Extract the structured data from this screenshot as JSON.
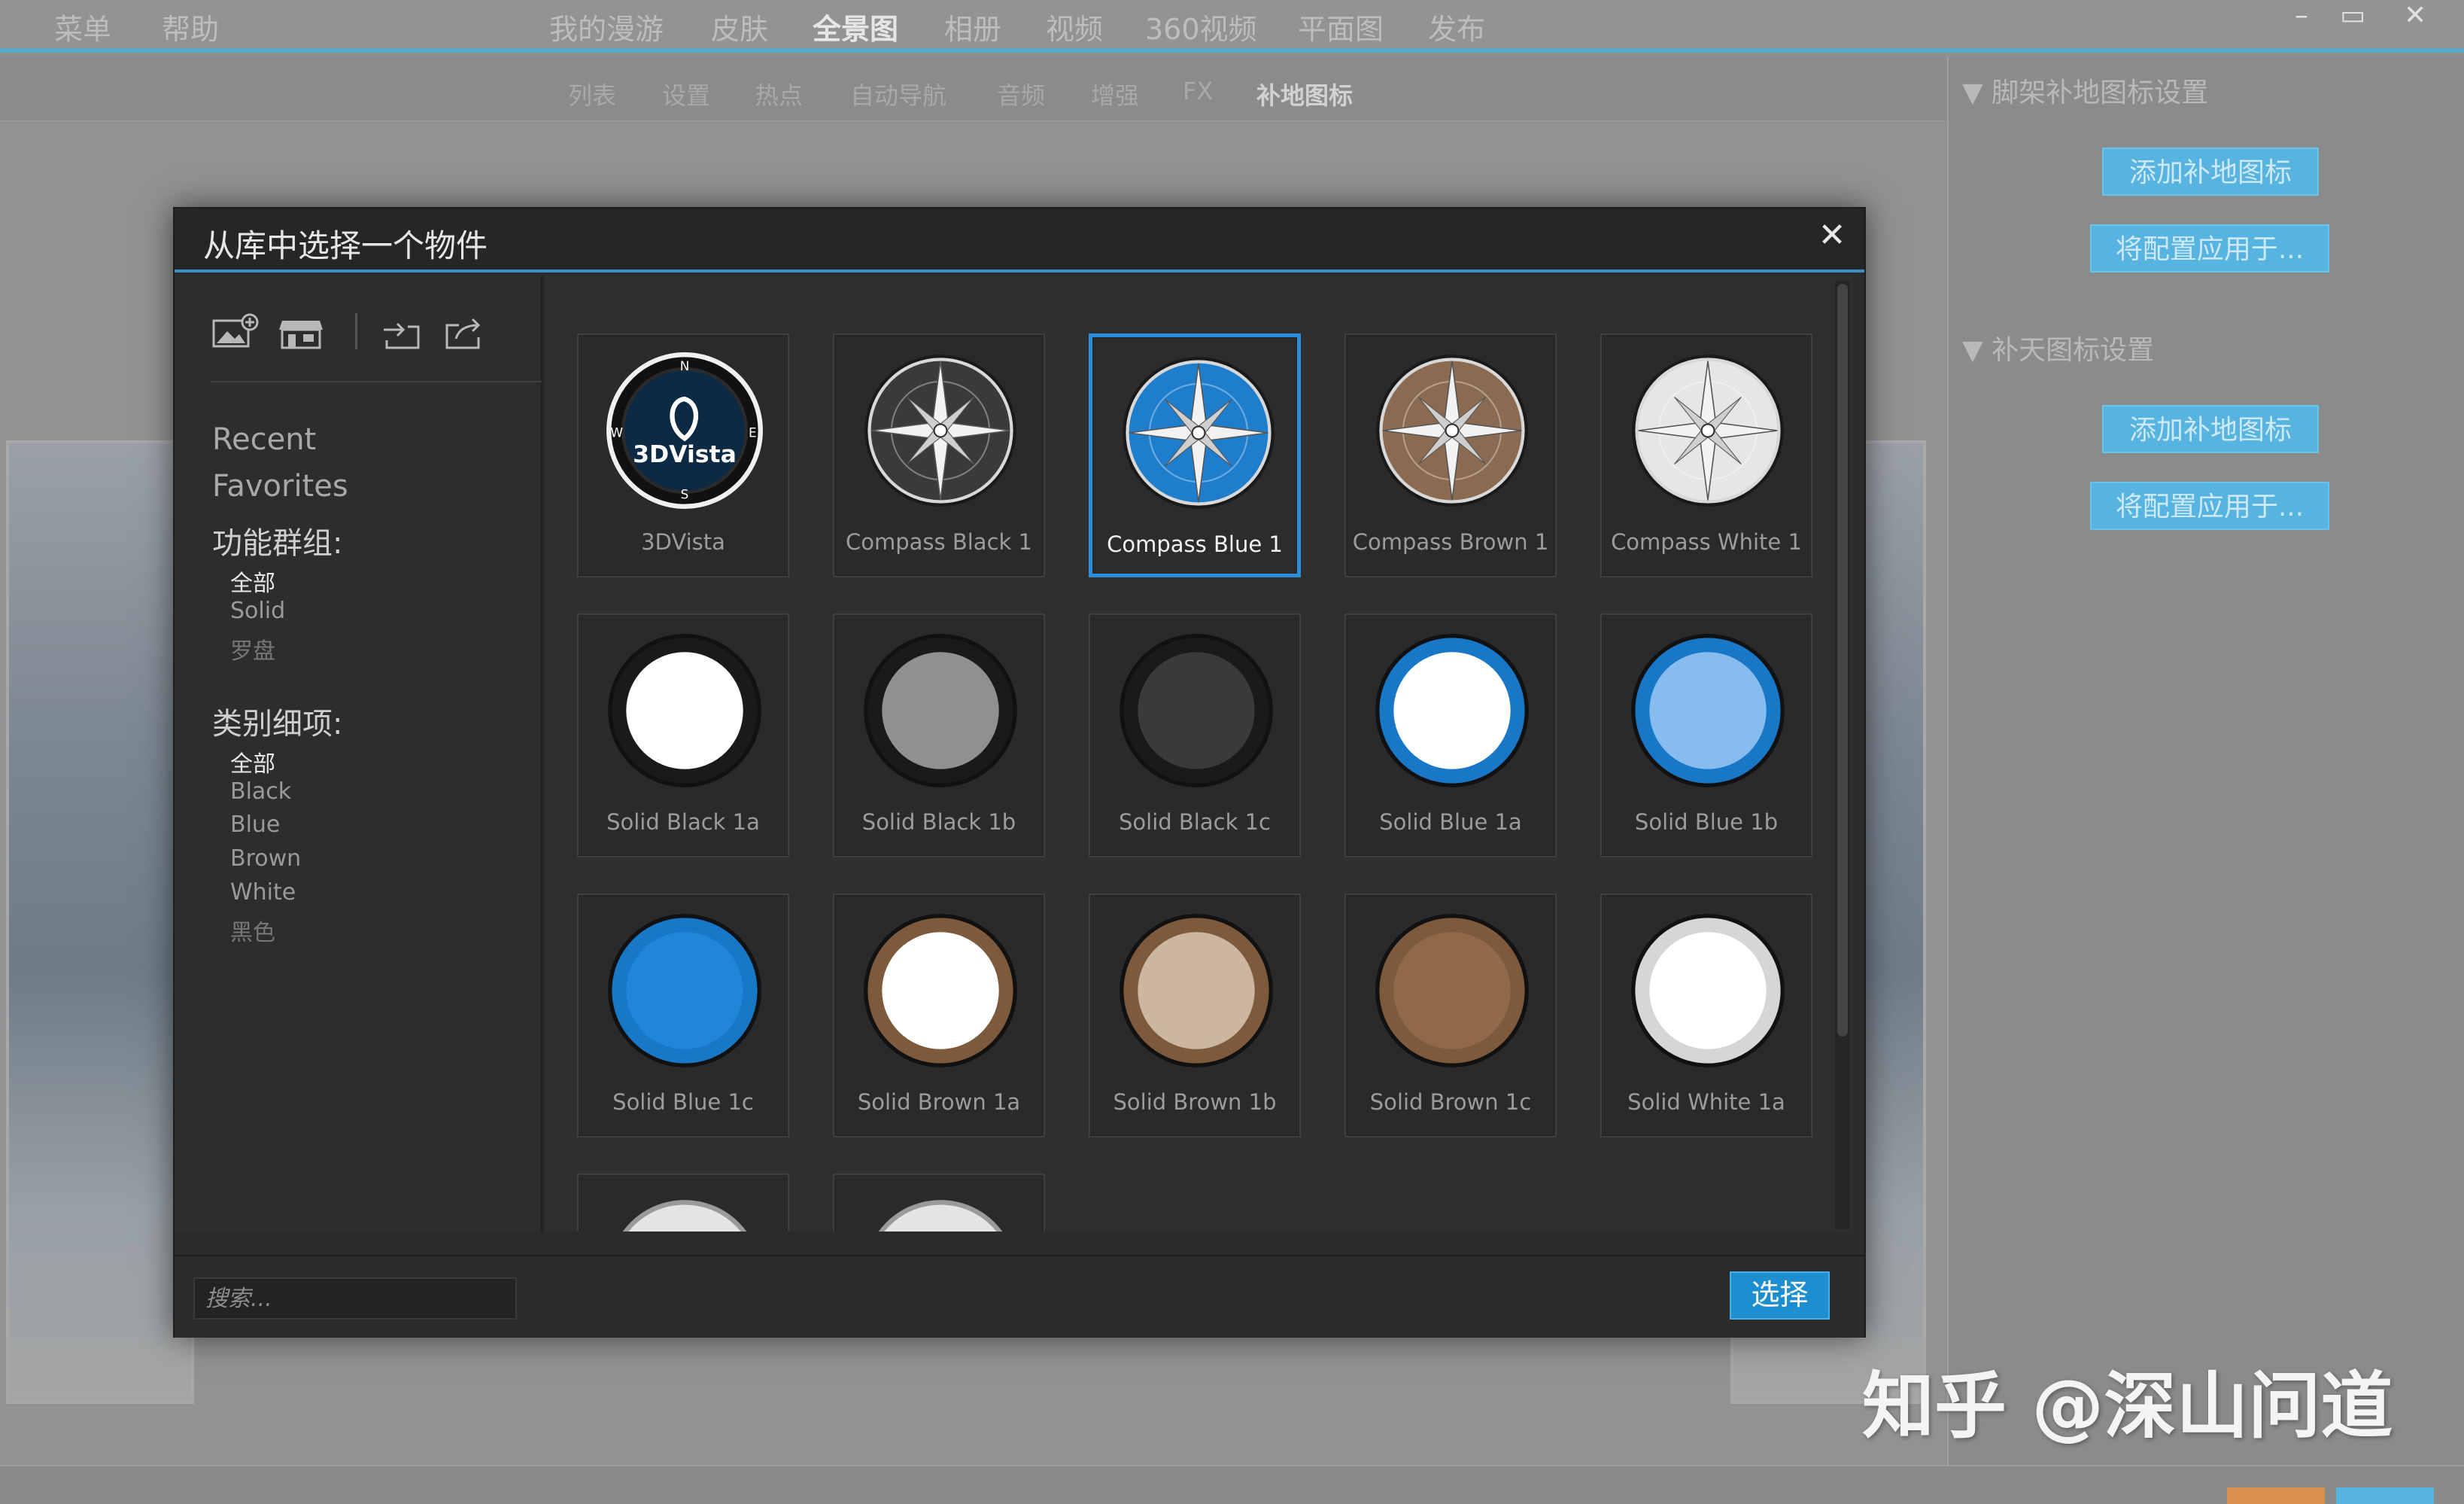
{
  "app": {
    "menu_left": [
      "菜单",
      "帮助"
    ],
    "menu_main": [
      "我的漫游",
      "皮肤",
      "全景图",
      "相册",
      "视频",
      "360视频",
      "平面图",
      "发布"
    ],
    "menu_active": "全景图",
    "window_controls": [
      "–",
      "▭",
      "✕"
    ],
    "subtabs": [
      "列表",
      "设置",
      "热点",
      "自动导航",
      "音频",
      "增强",
      "FX",
      "补地图标"
    ],
    "subtab_active": "补地图标"
  },
  "right_panel": {
    "section1_title": "▼ 脚架补地图标设置",
    "section1_add": "添加补地图标",
    "section1_apply": "将配置应用于...",
    "section2_title": "▼ 补天图标设置",
    "section2_add": "添加补地图标",
    "section2_apply": "将配置应用于..."
  },
  "dialog": {
    "title": "从库中选择一个物件",
    "close": "✕",
    "toolbar_icons": [
      "add-image-icon",
      "store-icon",
      "import-icon",
      "export-icon"
    ],
    "nav": [
      "Recent",
      "Favorites"
    ],
    "group_heading": "功能群组:",
    "groups": [
      "全部",
      "Solid",
      "罗盘"
    ],
    "category_heading": "类别细项:",
    "categories": [
      "全部",
      "Black",
      "Blue",
      "Brown",
      "White",
      "黑色"
    ],
    "items": [
      {
        "label": "3DVista",
        "kind": "logo"
      },
      {
        "label": "Compass Black 1",
        "kind": "compass",
        "color": "#3a3a3a"
      },
      {
        "label": "Compass Blue 1",
        "kind": "compass",
        "color": "#1f7ecc",
        "selected": true
      },
      {
        "label": "Compass Brown 1",
        "kind": "compass",
        "color": "#8a6a50"
      },
      {
        "label": "Compass White 1",
        "kind": "compass",
        "color": "#e6e6e6"
      },
      {
        "label": "Solid Black 1a",
        "kind": "solid",
        "ring": "#1a1a1a",
        "fill": "#ffffff"
      },
      {
        "label": "Solid Black 1b",
        "kind": "solid",
        "ring": "#1a1a1a",
        "fill": "#909090"
      },
      {
        "label": "Solid Black 1c",
        "kind": "solid",
        "ring": "#1a1a1a",
        "fill": "#3a3a3a"
      },
      {
        "label": "Solid Blue 1a",
        "kind": "solid",
        "ring": "#1877c7",
        "fill": "#ffffff"
      },
      {
        "label": "Solid Blue 1b",
        "kind": "solid",
        "ring": "#1877c7",
        "fill": "#86bdee"
      },
      {
        "label": "Solid Blue 1c",
        "kind": "solid",
        "ring": "#1877c7",
        "fill": "#1f86d8"
      },
      {
        "label": "Solid Brown 1a",
        "kind": "solid",
        "ring": "#7e5a3c",
        "fill": "#ffffff"
      },
      {
        "label": "Solid Brown 1b",
        "kind": "solid",
        "ring": "#7e5a3c",
        "fill": "#cbb6a2"
      },
      {
        "label": "Solid Brown 1c",
        "kind": "solid",
        "ring": "#7e5a3c",
        "fill": "#90694b"
      },
      {
        "label": "Solid White 1a",
        "kind": "solid",
        "ring": "#d6d6d6",
        "fill": "#ffffff"
      },
      {
        "label": "",
        "kind": "partial"
      },
      {
        "label": "",
        "kind": "partial"
      }
    ],
    "search_placeholder": "搜索...",
    "select_label": "选择"
  },
  "watermark": "知乎 @深山问道"
}
